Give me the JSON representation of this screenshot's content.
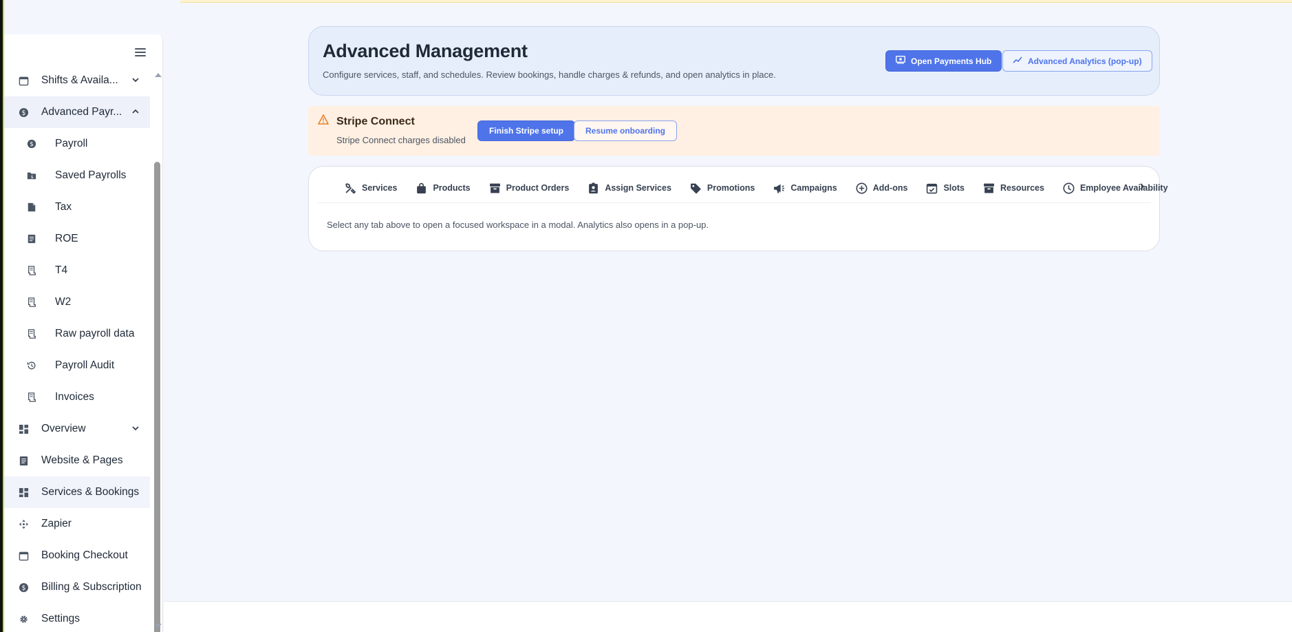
{
  "header": {
    "title": "Advanced Management",
    "subtitle": "Configure services, staff, and schedules. Review bookings, handle charges & refunds, and open analytics in place.",
    "payments_btn": "Open Payments Hub",
    "analytics_btn": "Advanced Analytics (pop-up)"
  },
  "stripe": {
    "title": "Stripe Connect",
    "subtitle": "Stripe Connect charges disabled",
    "finish_btn": "Finish Stripe setup",
    "resume_btn": "Resume onboarding"
  },
  "tabs": {
    "items": [
      {
        "label": "Services",
        "icon": "tools-icon"
      },
      {
        "label": "Products",
        "icon": "bag-icon"
      },
      {
        "label": "Product Orders",
        "icon": "archive-icon"
      },
      {
        "label": "Assign Services",
        "icon": "badge-icon"
      },
      {
        "label": "Promotions",
        "icon": "tag-icon"
      },
      {
        "label": "Campaigns",
        "icon": "megaphone-icon"
      },
      {
        "label": "Add-ons",
        "icon": "plus-circle-icon"
      },
      {
        "label": "Slots",
        "icon": "calendar-check-icon"
      },
      {
        "label": "Resources",
        "icon": "archive-icon"
      },
      {
        "label": "Employee Availability",
        "icon": "clock-icon"
      }
    ],
    "hint": "Select any tab above to open a focused workspace in a modal. Analytics also opens in a pop-up."
  },
  "sidebar": {
    "items": [
      {
        "label": "Shifts & Availa...",
        "icon": "calendar-icon",
        "chevron": "down"
      },
      {
        "label": "Advanced Payr...",
        "icon": "dollar-circle-icon",
        "chevron": "up"
      },
      {
        "label": "Payroll",
        "icon": "dollar-circle-icon"
      },
      {
        "label": "Saved Payrolls",
        "icon": "folder-dollar-icon"
      },
      {
        "label": "Tax",
        "icon": "file-icon"
      },
      {
        "label": "ROE",
        "icon": "document-icon"
      },
      {
        "label": "T4",
        "icon": "receipt-icon"
      },
      {
        "label": "W2",
        "icon": "receipt-icon"
      },
      {
        "label": "Raw payroll data",
        "icon": "receipt-icon"
      },
      {
        "label": "Payroll Audit",
        "icon": "history-icon"
      },
      {
        "label": "Invoices",
        "icon": "receipt-icon"
      },
      {
        "label": "Overview",
        "icon": "dashboard-icon",
        "chevron": "down"
      },
      {
        "label": "Website & Pages",
        "icon": "document-icon"
      },
      {
        "label": "Services & Bookings",
        "icon": "dashboard-icon"
      },
      {
        "label": "Zapier",
        "icon": "move-icon"
      },
      {
        "label": "Booking Checkout",
        "icon": "calendar-icon"
      },
      {
        "label": "Billing & Subscription",
        "icon": "dollar-circle-icon"
      },
      {
        "label": "Settings",
        "icon": "gear-icon"
      }
    ]
  },
  "colors": {
    "accent": "#4f74ea",
    "warning": "#e67e22",
    "banner_bg": "#fff0e3",
    "header_bg": "#e6eefb"
  }
}
